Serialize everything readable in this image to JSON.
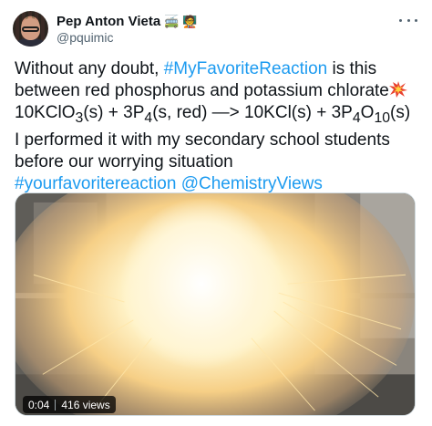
{
  "user": {
    "name": "Pep Anton Vieta",
    "name_emojis": [
      "🚎",
      "🧑‍🏫"
    ],
    "handle": "@pquimic"
  },
  "tweet": {
    "line1_prefix": "Without any doubt, ",
    "line1_hashtag": "#MyFavoriteReaction",
    "line1_suffix": " is this",
    "line2_text": "between red phosphorus and potassium chlorate",
    "line2_emoji": "collision-icon",
    "equation": {
      "part1": "10KClO",
      "sub1": "3",
      "part2": "(s) + 3P",
      "sub2": "4",
      "part3": "(s, red) —> 10KCl(s) + 3P",
      "sub3": "4",
      "part4": "O",
      "sub4": "10",
      "part5": "(s)"
    },
    "line4": "I performed it with my secondary school students",
    "line5": "before our worrying situation",
    "line6_hashtag": "#yourfavoritereaction",
    "line6_space": " ",
    "line6_mention": "@ChemistryViews"
  },
  "video": {
    "elapsed": "0:04",
    "views": "416 views"
  },
  "colors": {
    "link": "#1d9bf0",
    "text": "#0f1419",
    "muted": "#536471"
  }
}
